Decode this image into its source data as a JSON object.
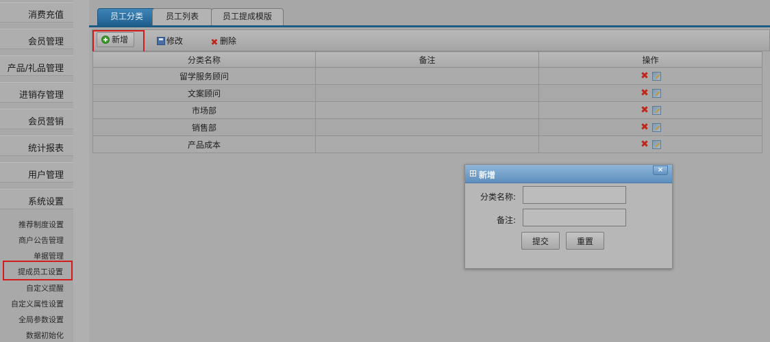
{
  "sidebar": {
    "menus": [
      {
        "label": "消费充值"
      },
      {
        "label": "会员管理"
      },
      {
        "label": "产品/礼品管理"
      },
      {
        "label": "进销存管理"
      },
      {
        "label": "会员营销"
      },
      {
        "label": "统计报表"
      },
      {
        "label": "用户管理"
      },
      {
        "label": "系统设置"
      }
    ],
    "submenu": [
      {
        "label": "推荐制度设置"
      },
      {
        "label": "商户公告管理"
      },
      {
        "label": "单据管理"
      },
      {
        "label": "提成员工设置",
        "active": true
      },
      {
        "label": "自定义提醒"
      },
      {
        "label": "自定义属性设置"
      },
      {
        "label": "全局参数设置"
      },
      {
        "label": "数据初始化"
      }
    ]
  },
  "tabs": [
    {
      "label": "员工分类",
      "active": true
    },
    {
      "label": "员工列表"
    },
    {
      "label": "员工提成模版"
    }
  ],
  "toolbar": {
    "add_label": "新增",
    "edit_label": "修改",
    "delete_label": "删除"
  },
  "grid": {
    "columns": [
      "分类名称",
      "备注",
      "操作"
    ],
    "rows": [
      {
        "name": "留学服务顾问",
        "note": ""
      },
      {
        "name": "文案顾问",
        "note": ""
      },
      {
        "name": "市场部",
        "note": ""
      },
      {
        "name": "销售部",
        "note": ""
      },
      {
        "name": "产品成本",
        "note": ""
      }
    ],
    "action_icons": [
      "delete-icon",
      "edit-icon"
    ]
  },
  "modal": {
    "title": "新增",
    "close_glyph": "×",
    "fields": [
      {
        "label": "分类名称:",
        "value": ""
      },
      {
        "label": "备注:",
        "value": ""
      }
    ],
    "submit_label": "提交",
    "reset_label": "重置"
  },
  "colors": {
    "tab_active": "#1f5f8f",
    "highlight_red": "#d21b1b",
    "modal_header": "#5d8fbd"
  }
}
